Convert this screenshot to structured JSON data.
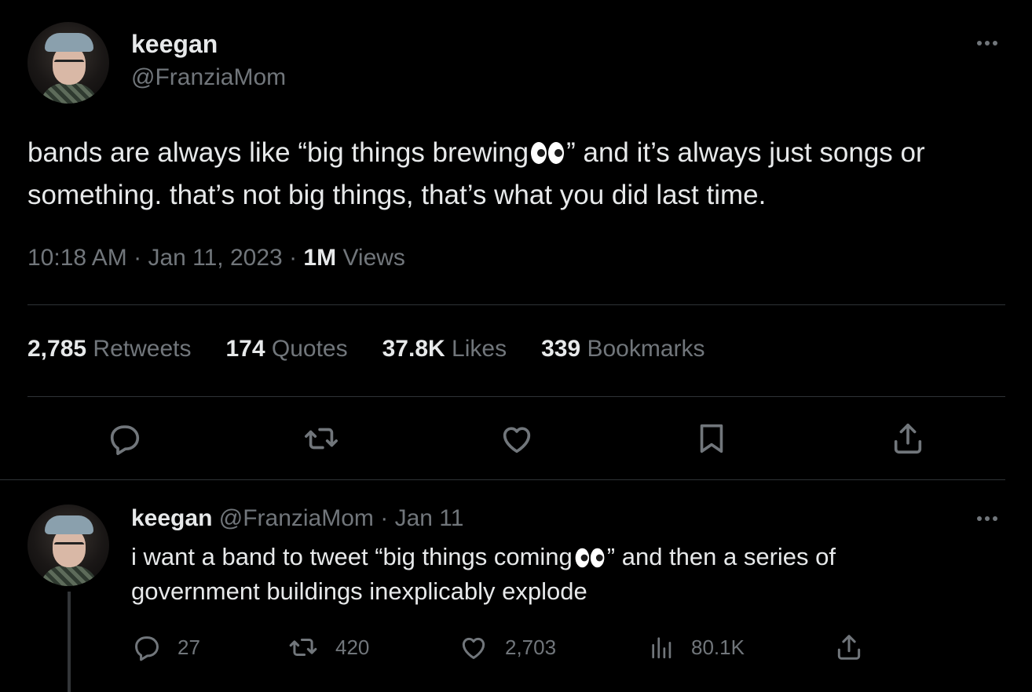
{
  "tweet": {
    "author_name": "keegan",
    "author_handle": "@FranziaMom",
    "text_part1": "bands are always like “big things brewing",
    "text_part2": "” and it’s always just songs or something. that’s not big things, that’s what you did last time.",
    "emoji": "eyes-emoji",
    "time": "10:18 AM",
    "date": "Jan 11, 2023",
    "views_count": "1M",
    "views_label": "Views",
    "stats": [
      {
        "count": "2,785",
        "label": "Retweets"
      },
      {
        "count": "174",
        "label": "Quotes"
      },
      {
        "count": "37.8K",
        "label": "Likes"
      },
      {
        "count": "339",
        "label": "Bookmarks"
      }
    ],
    "actions": [
      "reply-icon",
      "retweet-icon",
      "like-icon",
      "bookmark-icon",
      "share-icon"
    ]
  },
  "reply": {
    "author_name": "keegan",
    "author_handle": "@FranziaMom",
    "separator": "·",
    "date": "Jan 11",
    "text_part1": "i want a band to tweet “big things coming",
    "text_part2": "” and then a series of government buildings inexplicably explode",
    "counts": {
      "replies": "27",
      "retweets": "420",
      "likes": "2,703",
      "views": "80.1K"
    }
  },
  "colors": {
    "background": "#000000",
    "text": "#e7e9ea",
    "muted": "#71767b",
    "divider": "#2f3336"
  }
}
